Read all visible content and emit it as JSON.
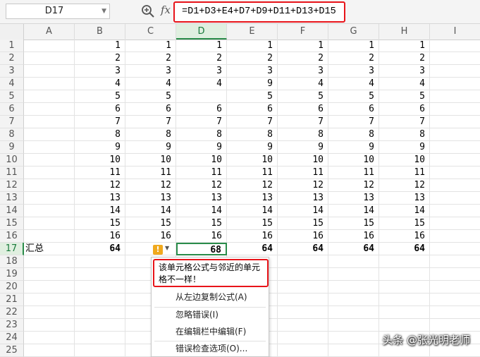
{
  "name_box": {
    "value": "D17"
  },
  "toolbar": {
    "zoom_icon": "zoom-icon",
    "fx_label": "fx"
  },
  "formula": {
    "value": "=D1+D3+E4+D7+D9+D11+D13+D15"
  },
  "columns": [
    "A",
    "B",
    "C",
    "D",
    "E",
    "F",
    "G",
    "H",
    "I"
  ],
  "rows": [
    "1",
    "2",
    "3",
    "4",
    "5",
    "6",
    "7",
    "8",
    "9",
    "10",
    "11",
    "12",
    "13",
    "14",
    "15",
    "16",
    "17",
    "18",
    "19",
    "20",
    "21",
    "22",
    "23",
    "24",
    "25"
  ],
  "selected": {
    "column": "D",
    "row": "17"
  },
  "cells": {
    "B": [
      "1",
      "2",
      "3",
      "4",
      "5",
      "6",
      "7",
      "8",
      "9",
      "10",
      "11",
      "12",
      "13",
      "14",
      "15",
      "16"
    ],
    "C": [
      "1",
      "2",
      "3",
      "4",
      "5",
      "6",
      "7",
      "8",
      "9",
      "10",
      "11",
      "12",
      "13",
      "14",
      "15",
      "16"
    ],
    "D": [
      "1",
      "2",
      "3",
      "4",
      "",
      "6",
      "7",
      "8",
      "9",
      "10",
      "11",
      "12",
      "13",
      "14",
      "15",
      "16"
    ],
    "E": [
      "1",
      "2",
      "3",
      "9",
      "5",
      "6",
      "7",
      "8",
      "9",
      "10",
      "11",
      "12",
      "13",
      "14",
      "15",
      "16"
    ],
    "F": [
      "1",
      "2",
      "3",
      "4",
      "5",
      "6",
      "7",
      "8",
      "9",
      "10",
      "11",
      "12",
      "13",
      "14",
      "15",
      "16"
    ],
    "G": [
      "1",
      "2",
      "3",
      "4",
      "5",
      "6",
      "7",
      "8",
      "9",
      "10",
      "11",
      "12",
      "13",
      "14",
      "15",
      "16"
    ],
    "H": [
      "1",
      "2",
      "3",
      "4",
      "5",
      "6",
      "7",
      "8",
      "9",
      "10",
      "11",
      "12",
      "13",
      "14",
      "15",
      "16"
    ]
  },
  "totals_row": {
    "label": "汇总",
    "B": "64",
    "D": "68",
    "E": "64",
    "F": "64",
    "G": "64",
    "H": "64"
  },
  "error_button": {
    "icon": "!"
  },
  "error_menu": {
    "message": "该单元格公式与邻近的单元格不一样！",
    "items": [
      "从左边复制公式(A)",
      "忽略错误(I)",
      "在编辑栏中编辑(F)",
      "错误检查选项(O)..."
    ]
  },
  "watermark": "头条 @张光明老师"
}
